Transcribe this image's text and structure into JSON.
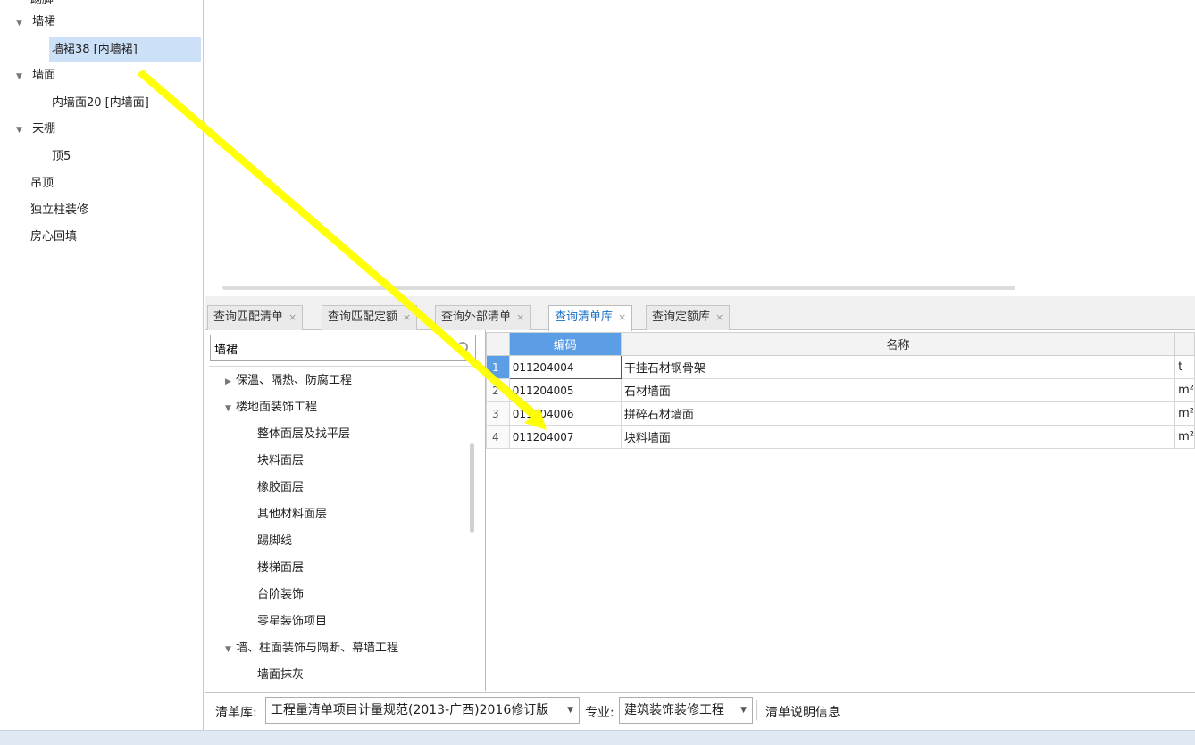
{
  "left_tree": {
    "top_partial": "踢脚",
    "items": [
      {
        "label": "墙裙",
        "arrow": "▼"
      },
      {
        "label": "墙裙38 [内墙裙]",
        "arrow": ""
      },
      {
        "label": "墙面",
        "arrow": "▼"
      },
      {
        "label": "内墙面20 [内墙面]",
        "arrow": ""
      },
      {
        "label": "天棚",
        "arrow": "▼"
      },
      {
        "label": "顶5",
        "arrow": ""
      },
      {
        "label": "吊顶",
        "arrow": ""
      },
      {
        "label": "独立柱装修",
        "arrow": ""
      },
      {
        "label": "房心回填",
        "arrow": ""
      }
    ]
  },
  "tabs": [
    {
      "label": "查询匹配清单",
      "close": "×"
    },
    {
      "label": "查询匹配定额",
      "close": "×"
    },
    {
      "label": "查询外部清单",
      "close": "×"
    },
    {
      "label": "查询清单库",
      "close": "×"
    },
    {
      "label": "查询定额库",
      "close": "×"
    }
  ],
  "search": {
    "value": "墙裙",
    "placeholder": ""
  },
  "lib_tree": {
    "items": [
      {
        "label": "保温、隔热、防腐工程",
        "arrow": "▶"
      },
      {
        "label": "楼地面装饰工程",
        "arrow": "▼"
      },
      {
        "label": "整体面层及找平层",
        "arrow": ""
      },
      {
        "label": "块料面层",
        "arrow": ""
      },
      {
        "label": "橡胶面层",
        "arrow": ""
      },
      {
        "label": "其他材料面层",
        "arrow": ""
      },
      {
        "label": "踢脚线",
        "arrow": ""
      },
      {
        "label": "楼梯面层",
        "arrow": ""
      },
      {
        "label": "台阶装饰",
        "arrow": ""
      },
      {
        "label": "零星装饰项目",
        "arrow": ""
      },
      {
        "label": "墙、柱面装饰与隔断、幕墙工程",
        "arrow": "▼"
      },
      {
        "label": "墙面抹灰",
        "arrow": ""
      }
    ]
  },
  "grid": {
    "headers": {
      "code": "编码",
      "name": "名称"
    },
    "rows": [
      {
        "n": "1",
        "code": "011204004",
        "name": "干挂石材钢骨架",
        "unit": "t"
      },
      {
        "n": "2",
        "code": "011204005",
        "name": "石材墙面",
        "unit": "m²"
      },
      {
        "n": "3",
        "code": "011204006",
        "name": "拼碎石材墙面",
        "unit": "m²"
      },
      {
        "n": "4",
        "code": "011204007",
        "name": "块料墙面",
        "unit": "m²"
      }
    ]
  },
  "bottom_bar": {
    "lib_label": "清单库:",
    "lib_value": "工程量清单项目计量规范(2013-广西)2016修订版",
    "spec_label": "专业:",
    "spec_value": "建筑装饰装修工程",
    "info_label": "清单说明信息"
  },
  "colors": {
    "selection": "#cce0f7",
    "active_tab": "#1a6fc4",
    "grid_header_selected": "#5b9ee6",
    "drag_arrow": "#ffff00"
  },
  "icons": {
    "search": "search-icon",
    "dropdown": "chevron-down-icon",
    "close": "close-icon"
  }
}
